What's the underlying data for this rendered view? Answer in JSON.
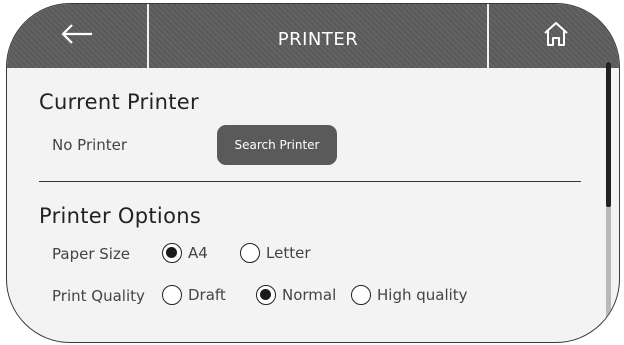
{
  "header": {
    "title": "PRINTER",
    "back_icon": "arrow-left-icon",
    "home_icon": "home-icon"
  },
  "current_printer": {
    "heading": "Current Printer",
    "status": "No Printer",
    "search_button_label": "Search Printer"
  },
  "printer_options": {
    "heading": "Printer Options",
    "paper_size": {
      "label": "Paper Size",
      "options": [
        "A4",
        "Letter"
      ],
      "selected": "A4"
    },
    "print_quality": {
      "label": "Print Quality",
      "options": [
        "Draft",
        "Normal",
        "High quality"
      ],
      "selected": "Normal"
    }
  },
  "colors": {
    "header_bg": "#5d5d5d",
    "button_bg": "#5a5a5a",
    "text": "#444444"
  }
}
